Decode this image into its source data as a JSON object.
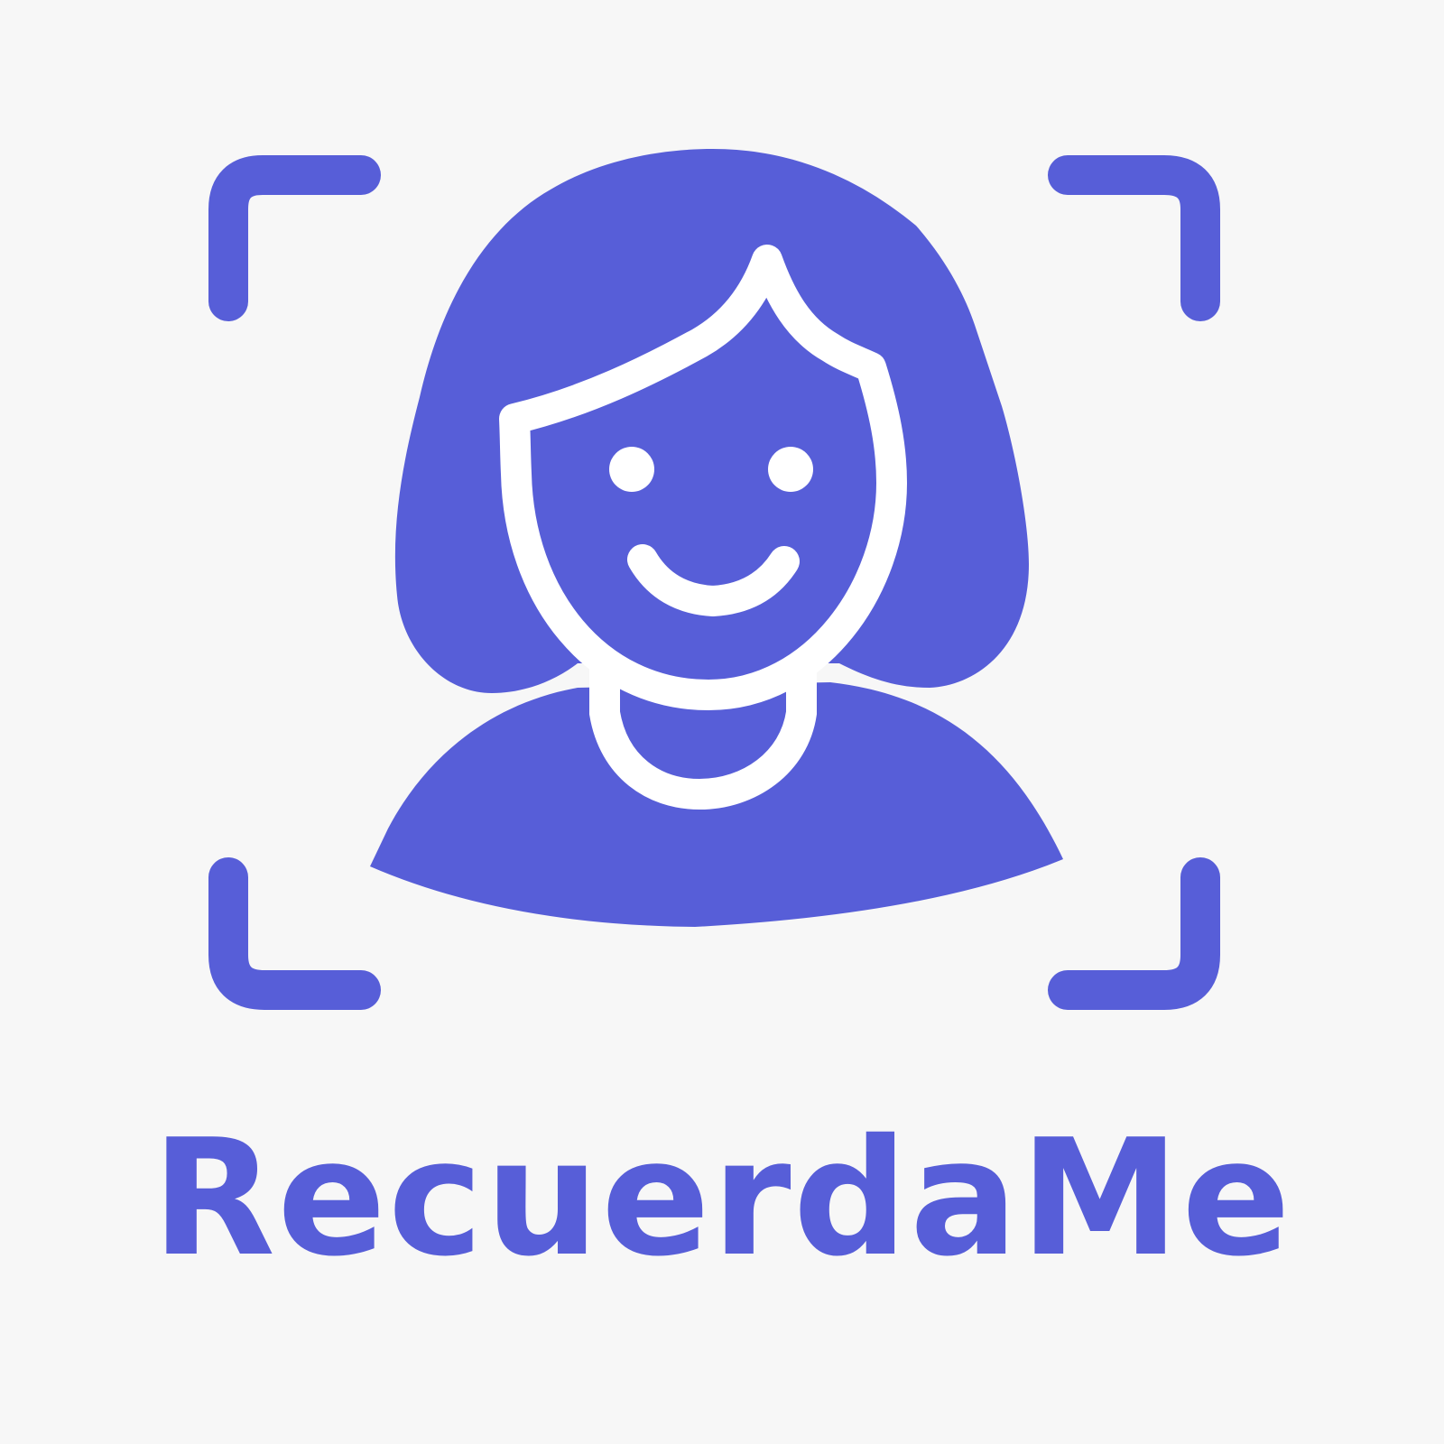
{
  "app": {
    "name": "RecuerdaMe"
  },
  "logo": {
    "icon": "face-scan-woman-icon",
    "frame_icon": "scan-frame-corners-icon"
  },
  "colors": {
    "brand": "#575ed8",
    "background": "#f7f7f7",
    "face_line": "#ffffff"
  }
}
